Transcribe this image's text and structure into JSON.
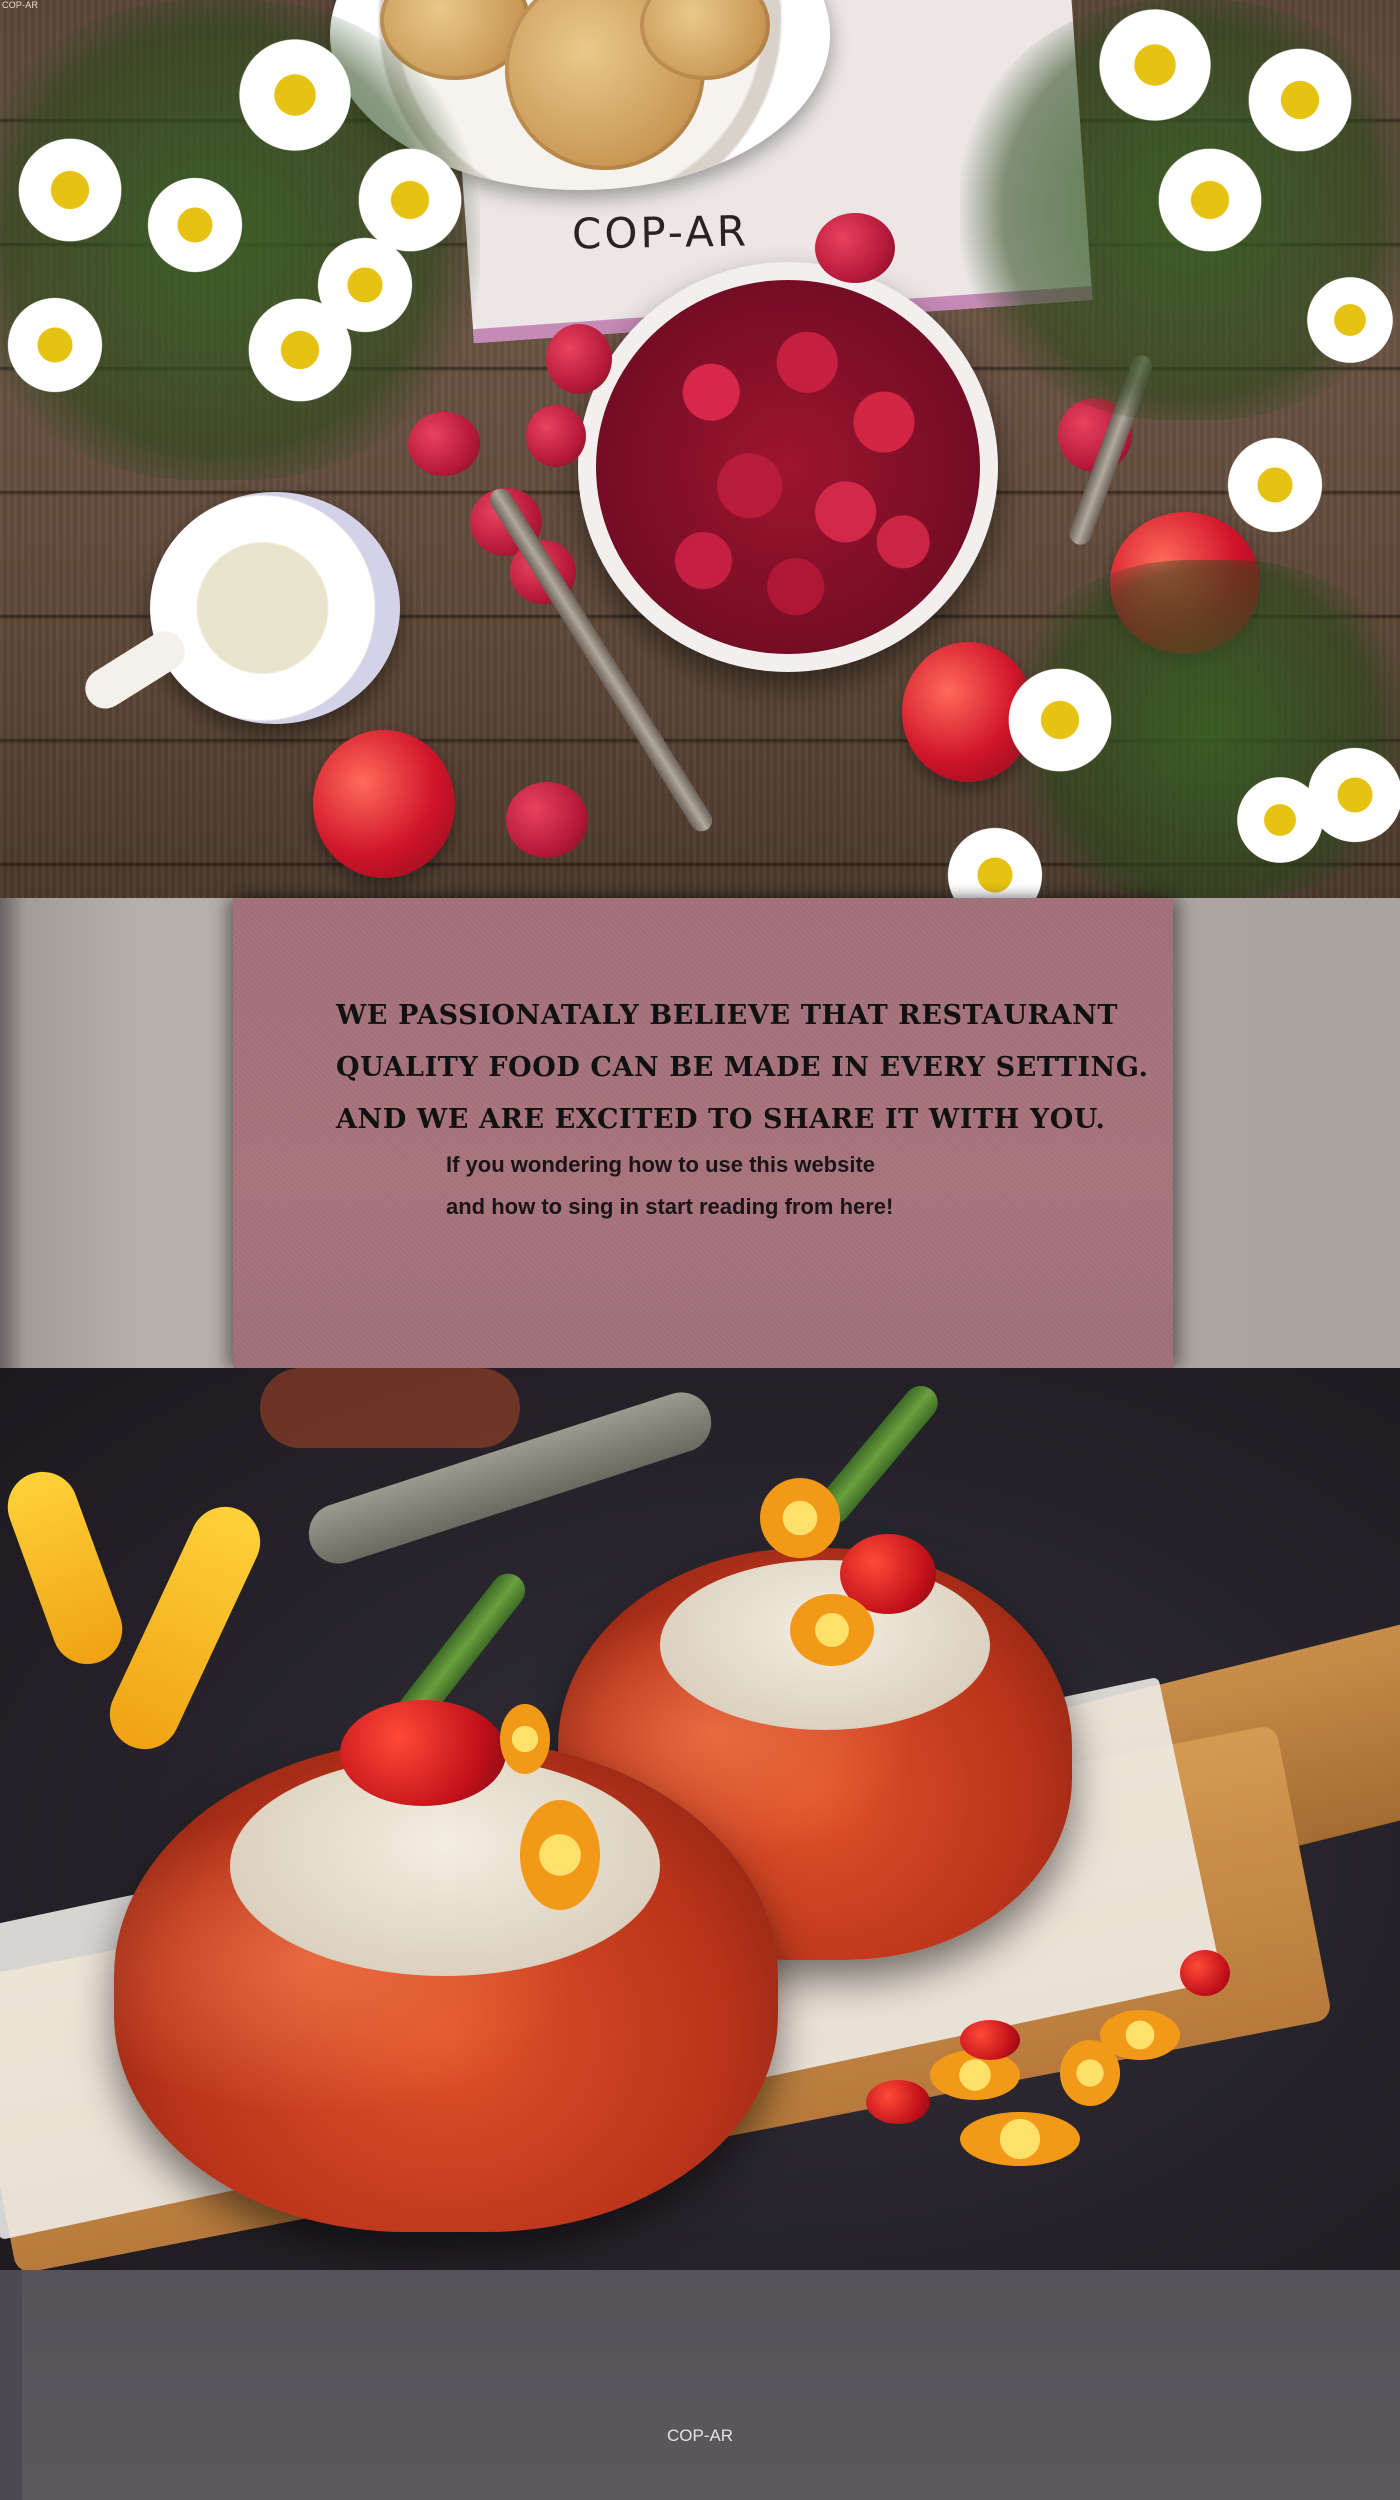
{
  "hero": {
    "corner_label": "COP-AR",
    "brand": "COP-AR",
    "image_alt": "raspberries-cookies-daisies-table-photo"
  },
  "banner": {
    "headline_lines": [
      "WE  PASSIONATALY BELIEVE THAT RESTAURANT",
      "QUALITY FOOD CAN BE MADE IN EVERY SETTING.",
      "AND WE ARE EXCITED TO SHARE IT WITH YOU."
    ],
    "intro_lines": [
      "If you wondering how to use this website",
      "and how to sing in start reading from here!"
    ],
    "card_color": "#a3707a"
  },
  "food_photo": {
    "image_alt": "stuffed-tomatoes-on-board-photo"
  },
  "footer": {
    "text": "COP-AR"
  },
  "colors": {
    "banner_card": "#a3707a",
    "footer_bg": "#5c575d",
    "wood": "#5a4638"
  }
}
